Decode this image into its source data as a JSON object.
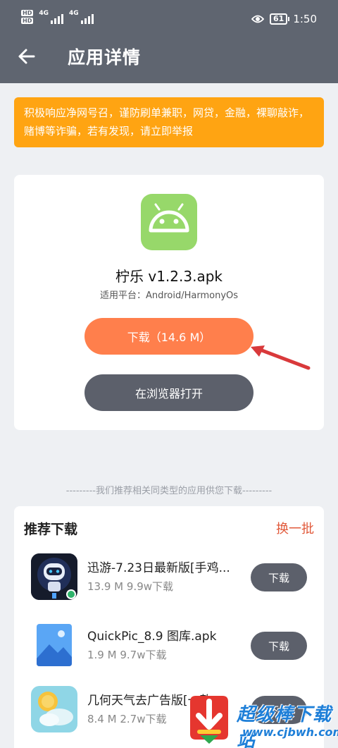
{
  "status_bar": {
    "hd1": "HD",
    "hd2": "HD",
    "net1": "4G",
    "net2": "4G",
    "battery": "61",
    "time": "1:50"
  },
  "nav": {
    "back_icon": "arrow-left-icon",
    "title": "应用详情"
  },
  "notice": {
    "text": "积极响应净网号召，谨防刷单兼职，网贷，金融，裸聊敲诈，赌博等诈骗，若有发现，请立即举报"
  },
  "app": {
    "icon": "android-icon",
    "name": "柠乐 v1.2.3.apk",
    "platform": "适用平台：Android/HarmonyOs",
    "download_label": "下载（14.6 M）",
    "browser_label": "在浏览器打开"
  },
  "recommend_divider": "---------我们推荐相关同类型的应用供您下载---------",
  "recommend": {
    "title": "推荐下载",
    "refresh": "换一批",
    "items": [
      {
        "name": "迅游-7.23日最新版[手鸡...",
        "meta": "13.9 M  9.9w下载",
        "button": "下载",
        "icon": "robot-icon"
      },
      {
        "name": "QuickPic_8.9 图库.apk",
        "meta": "1.9 M  9.7w下载",
        "button": "下载",
        "icon": "gallery-icon"
      },
      {
        "name": "几何天气去广告版[一款...",
        "meta": "8.4 M  2.7w下载",
        "button": "下载",
        "icon": "weather-icon"
      }
    ]
  },
  "watermark": {
    "text": "超级棒下载站",
    "url": "www.cjbwh.com"
  },
  "colors": {
    "header": "#5f6570",
    "notice": "#ffa412",
    "download_button": "#ff7f4c",
    "dark_button": "#5c606b",
    "refresh": "#e1593a"
  }
}
